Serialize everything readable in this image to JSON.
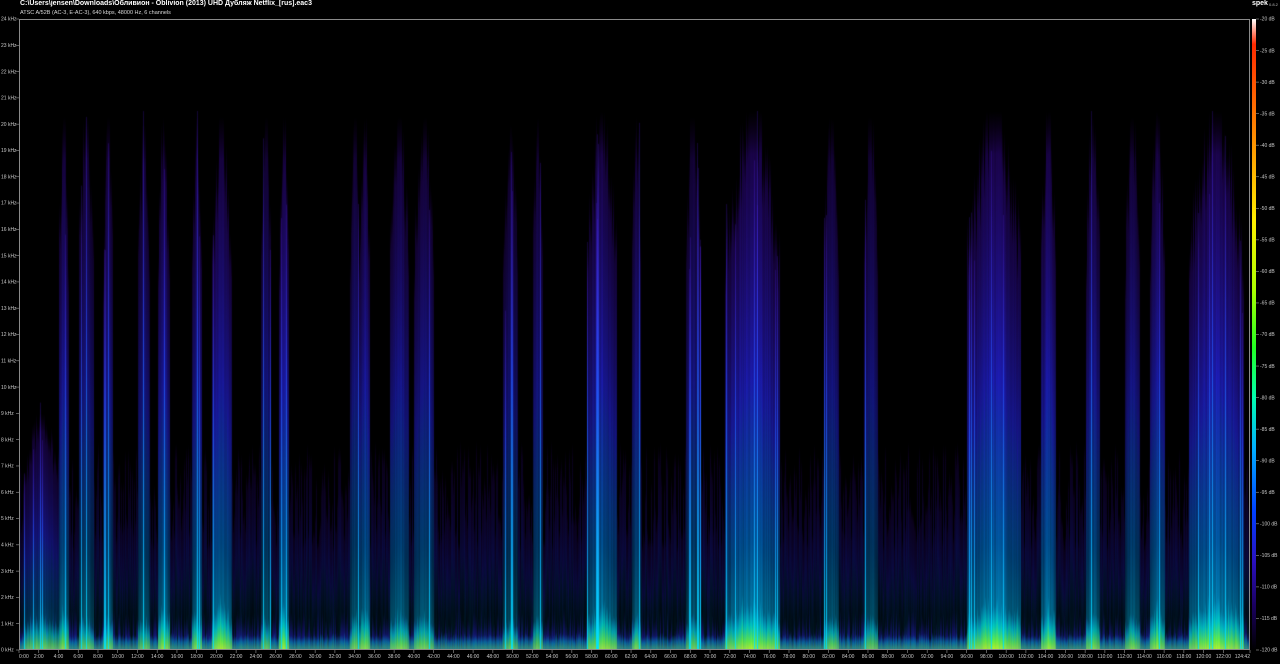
{
  "header": {
    "file_path": "C:\\Users\\jensen\\Downloads\\Обливион - Oblivion (2013) UHD Дубляж Netflix_[rus].eac3",
    "stream_info": "ATSC A/52B (AC-3, E-AC-3), 640 kbps, 48000 Hz, 6 channels",
    "app_name": "spek",
    "app_version": "0.8.2"
  },
  "colors": {
    "background": "#000000",
    "low_energy": "#2a10c0",
    "mid_energy": "#00b0ff",
    "high_energy": "#aaff00",
    "peak": "#ff2a00"
  },
  "chart_data": {
    "type": "heatmap",
    "title": "",
    "xlabel": "",
    "ylabel": "",
    "x_range_seconds": [
      0,
      7482
    ],
    "y_range_khz": [
      0,
      24
    ],
    "colorbar_range_db": [
      -120,
      -20
    ],
    "y_ticks": [
      "24 kHz",
      "23 kHz",
      "22 kHz",
      "21 kHz",
      "20 kHz",
      "19 kHz",
      "18 kHz",
      "17 kHz",
      "16 kHz",
      "15 kHz",
      "14 kHz",
      "13 kHz",
      "12 kHz",
      "11 kHz",
      "10 kHz",
      "9 kHz",
      "8 kHz",
      "7 kHz",
      "6 kHz",
      "5 kHz",
      "4 kHz",
      "3 kHz",
      "2 kHz",
      "1 kHz",
      "0 kHz"
    ],
    "x_ticks": [
      "0:00",
      "2:00",
      "4:00",
      "6:00",
      "8:00",
      "10:00",
      "12:00",
      "14:00",
      "16:00",
      "18:00",
      "20:00",
      "22:00",
      "24:00",
      "26:00",
      "28:00",
      "30:00",
      "32:00",
      "34:00",
      "36:00",
      "38:00",
      "40:00",
      "42:00",
      "44:00",
      "46:00",
      "48:00",
      "50:00",
      "52:00",
      "54:00",
      "56:00",
      "58:00",
      "60:00",
      "62:00",
      "64:00",
      "66:00",
      "68:00",
      "70:00",
      "72:00",
      "74:00",
      "76:00",
      "78:00",
      "80:00",
      "82:00",
      "84:00",
      "86:00",
      "88:00",
      "90:00",
      "92:00",
      "94:00",
      "96:00",
      "98:00",
      "100:00",
      "102:00",
      "104:00",
      "106:00",
      "108:00",
      "110:00",
      "112:00",
      "114:00",
      "116:00",
      "118:00",
      "120:00",
      "122:00",
      "124:42"
    ],
    "colorbar_ticks": [
      "-20 dB",
      "-25 dB",
      "-30 dB",
      "-35 dB",
      "-40 dB",
      "-45 dB",
      "-50 dB",
      "-55 dB",
      "-60 dB",
      "-65 dB",
      "-70 dB",
      "-75 dB",
      "-80 dB",
      "-85 dB",
      "-90 dB",
      "-95 dB",
      "-100 dB",
      "-105 dB",
      "-110 dB",
      "-115 dB",
      "-120 dB"
    ],
    "bandwidth_cutoff_khz": 20.5,
    "loud_segments": [
      {
        "t_start_min": 0.5,
        "t_end_min": 4.0,
        "max_khz": 9,
        "energy": 0.55
      },
      {
        "t_start_min": 4.0,
        "t_end_min": 5.0,
        "max_khz": 20.3,
        "energy": 0.7
      },
      {
        "t_start_min": 6.0,
        "t_end_min": 7.5,
        "max_khz": 20.3,
        "energy": 0.55
      },
      {
        "t_start_min": 8.5,
        "t_end_min": 9.5,
        "max_khz": 20.3,
        "energy": 0.6
      },
      {
        "t_start_min": 12.0,
        "t_end_min": 13.2,
        "max_khz": 20.0,
        "energy": 0.55
      },
      {
        "t_start_min": 14.0,
        "t_end_min": 15.2,
        "max_khz": 20.3,
        "energy": 0.75
      },
      {
        "t_start_min": 17.5,
        "t_end_min": 18.5,
        "max_khz": 20.3,
        "energy": 0.7
      },
      {
        "t_start_min": 19.5,
        "t_end_min": 21.5,
        "max_khz": 20.3,
        "energy": 0.8
      },
      {
        "t_start_min": 24.5,
        "t_end_min": 25.5,
        "max_khz": 20.3,
        "energy": 0.55
      },
      {
        "t_start_min": 26.3,
        "t_end_min": 27.3,
        "max_khz": 20.3,
        "energy": 0.8
      },
      {
        "t_start_min": 33.5,
        "t_end_min": 34.5,
        "max_khz": 20.3,
        "energy": 0.6
      },
      {
        "t_start_min": 34.5,
        "t_end_min": 35.5,
        "max_khz": 20.3,
        "energy": 0.75
      },
      {
        "t_start_min": 37.5,
        "t_end_min": 39.5,
        "max_khz": 20.3,
        "energy": 0.65
      },
      {
        "t_start_min": 40.0,
        "t_end_min": 42.0,
        "max_khz": 20.3,
        "energy": 0.6
      },
      {
        "t_start_min": 49.0,
        "t_end_min": 50.5,
        "max_khz": 20.0,
        "energy": 0.5
      },
      {
        "t_start_min": 52.0,
        "t_end_min": 53.0,
        "max_khz": 20.3,
        "energy": 0.55
      },
      {
        "t_start_min": 57.5,
        "t_end_min": 60.5,
        "max_khz": 20.5,
        "energy": 0.75
      },
      {
        "t_start_min": 62.0,
        "t_end_min": 63.0,
        "max_khz": 20.3,
        "energy": 0.6
      },
      {
        "t_start_min": 67.5,
        "t_end_min": 69.0,
        "max_khz": 20.3,
        "energy": 0.55
      },
      {
        "t_start_min": 71.5,
        "t_end_min": 77.0,
        "max_khz": 20.5,
        "energy": 0.85
      },
      {
        "t_start_min": 81.5,
        "t_end_min": 83.0,
        "max_khz": 20.3,
        "energy": 0.6
      },
      {
        "t_start_min": 85.5,
        "t_end_min": 87.0,
        "max_khz": 20.3,
        "energy": 0.55
      },
      {
        "t_start_min": 96.0,
        "t_end_min": 101.5,
        "max_khz": 20.5,
        "energy": 0.85
      },
      {
        "t_start_min": 103.5,
        "t_end_min": 105.0,
        "max_khz": 20.5,
        "energy": 0.8
      },
      {
        "t_start_min": 108.0,
        "t_end_min": 109.5,
        "max_khz": 20.3,
        "energy": 0.65
      },
      {
        "t_start_min": 112.0,
        "t_end_min": 113.5,
        "max_khz": 20.3,
        "energy": 0.6
      },
      {
        "t_start_min": 114.5,
        "t_end_min": 116.0,
        "max_khz": 20.5,
        "energy": 0.75
      },
      {
        "t_start_min": 118.5,
        "t_end_min": 124.0,
        "max_khz": 20.5,
        "energy": 0.85
      }
    ]
  }
}
